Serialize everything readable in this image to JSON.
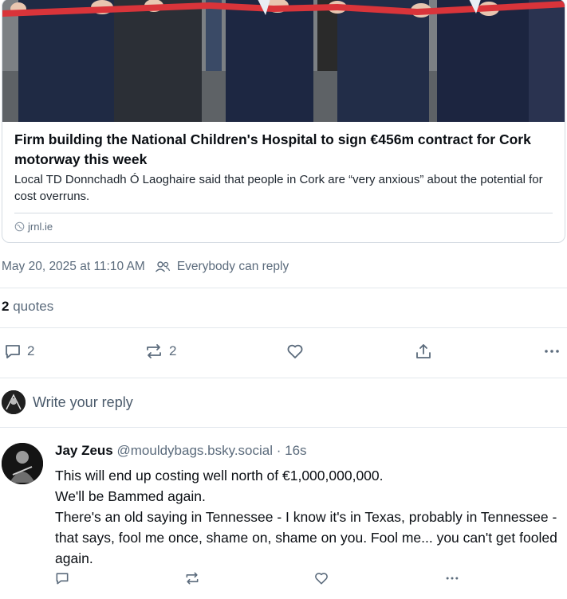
{
  "card": {
    "title": "Firm building the National Children's Hospital to sign €456m contract for Cork motorway this week",
    "description": "Local TD Donnchadh Ó Laoghaire said that people in Cork are “very anxious” about the potential for cost overruns.",
    "domain": "jrnl.ie"
  },
  "meta": {
    "timestamp": "May 20, 2025 at 11:10 AM",
    "reply_setting": "Everybody can reply"
  },
  "quotes": {
    "count": "2",
    "label": "quotes"
  },
  "actions": {
    "reply_count": "2",
    "repost_count": "2"
  },
  "reply_box": {
    "placeholder": "Write your reply"
  },
  "reply_post": {
    "author_name": "Jay Zeus",
    "author_handle": "@mouldybags.bsky.social",
    "age": "· 16s",
    "lines": [
      "This will end up costing well north of €1,000,000,000.",
      "We'll be Bammed again.",
      "There's an old saying in Tennessee - I know it's in Texas, probably in Tennessee - that says, fool me once, shame on, shame on you. Fool me... you can't get fooled again."
    ]
  },
  "colors": {
    "accent_ribbon": "#d9343a",
    "muted": "#5b6b7c",
    "border": "#d4dbe2"
  },
  "icons": [
    "globe-icon",
    "people-icon",
    "reply-icon",
    "repost-icon",
    "heart-icon",
    "share-icon",
    "more-icon"
  ]
}
